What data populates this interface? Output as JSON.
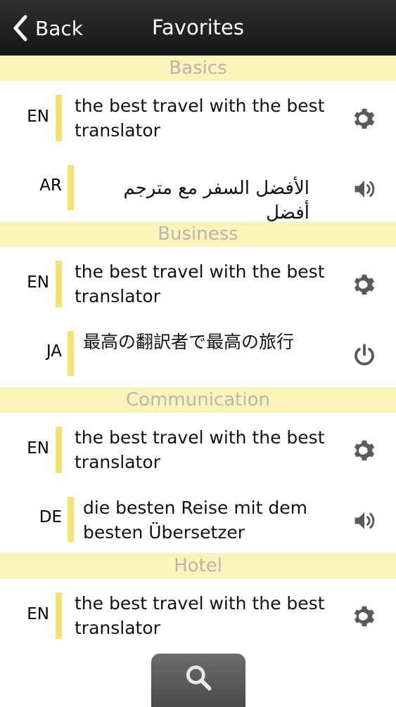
{
  "navbar": {
    "back_label": "Back",
    "title": "Favorites"
  },
  "sections": [
    {
      "header": "Basics",
      "rows": [
        {
          "lang": "EN",
          "text": "the best travel with the best translator",
          "action_icon": "gear-icon"
        },
        {
          "lang": "AR",
          "text": "الأفضل السفر مع مترجم أفضل",
          "action_icon": "speaker-icon"
        }
      ]
    },
    {
      "header": "Business",
      "rows": [
        {
          "lang": "EN",
          "text": "the best travel with the best translator",
          "action_icon": "gear-icon"
        },
        {
          "lang": "JA",
          "text": "最高の翻訳者で最高の旅行",
          "action_icon": "power-icon"
        }
      ]
    },
    {
      "header": "Communication",
      "rows": [
        {
          "lang": "EN",
          "text": "the best travel with the best translator",
          "action_icon": "gear-icon"
        },
        {
          "lang": "DE",
          "text": "die besten Reise mit dem besten Übersetzer",
          "action_icon": "speaker-icon"
        }
      ]
    },
    {
      "header": "Hotel",
      "rows": [
        {
          "lang": "EN",
          "text": "the best travel with the best translator",
          "action_icon": "gear-icon"
        }
      ]
    }
  ],
  "bottom": {
    "icon": "search-icon"
  },
  "colors": {
    "navbar": "#1f1f1f",
    "section_header_bg": "#fbf3b7",
    "section_header_text": "#b5b5b5",
    "accent_bar": "#f5e06d",
    "icon_gray": "#5a5a5a"
  }
}
